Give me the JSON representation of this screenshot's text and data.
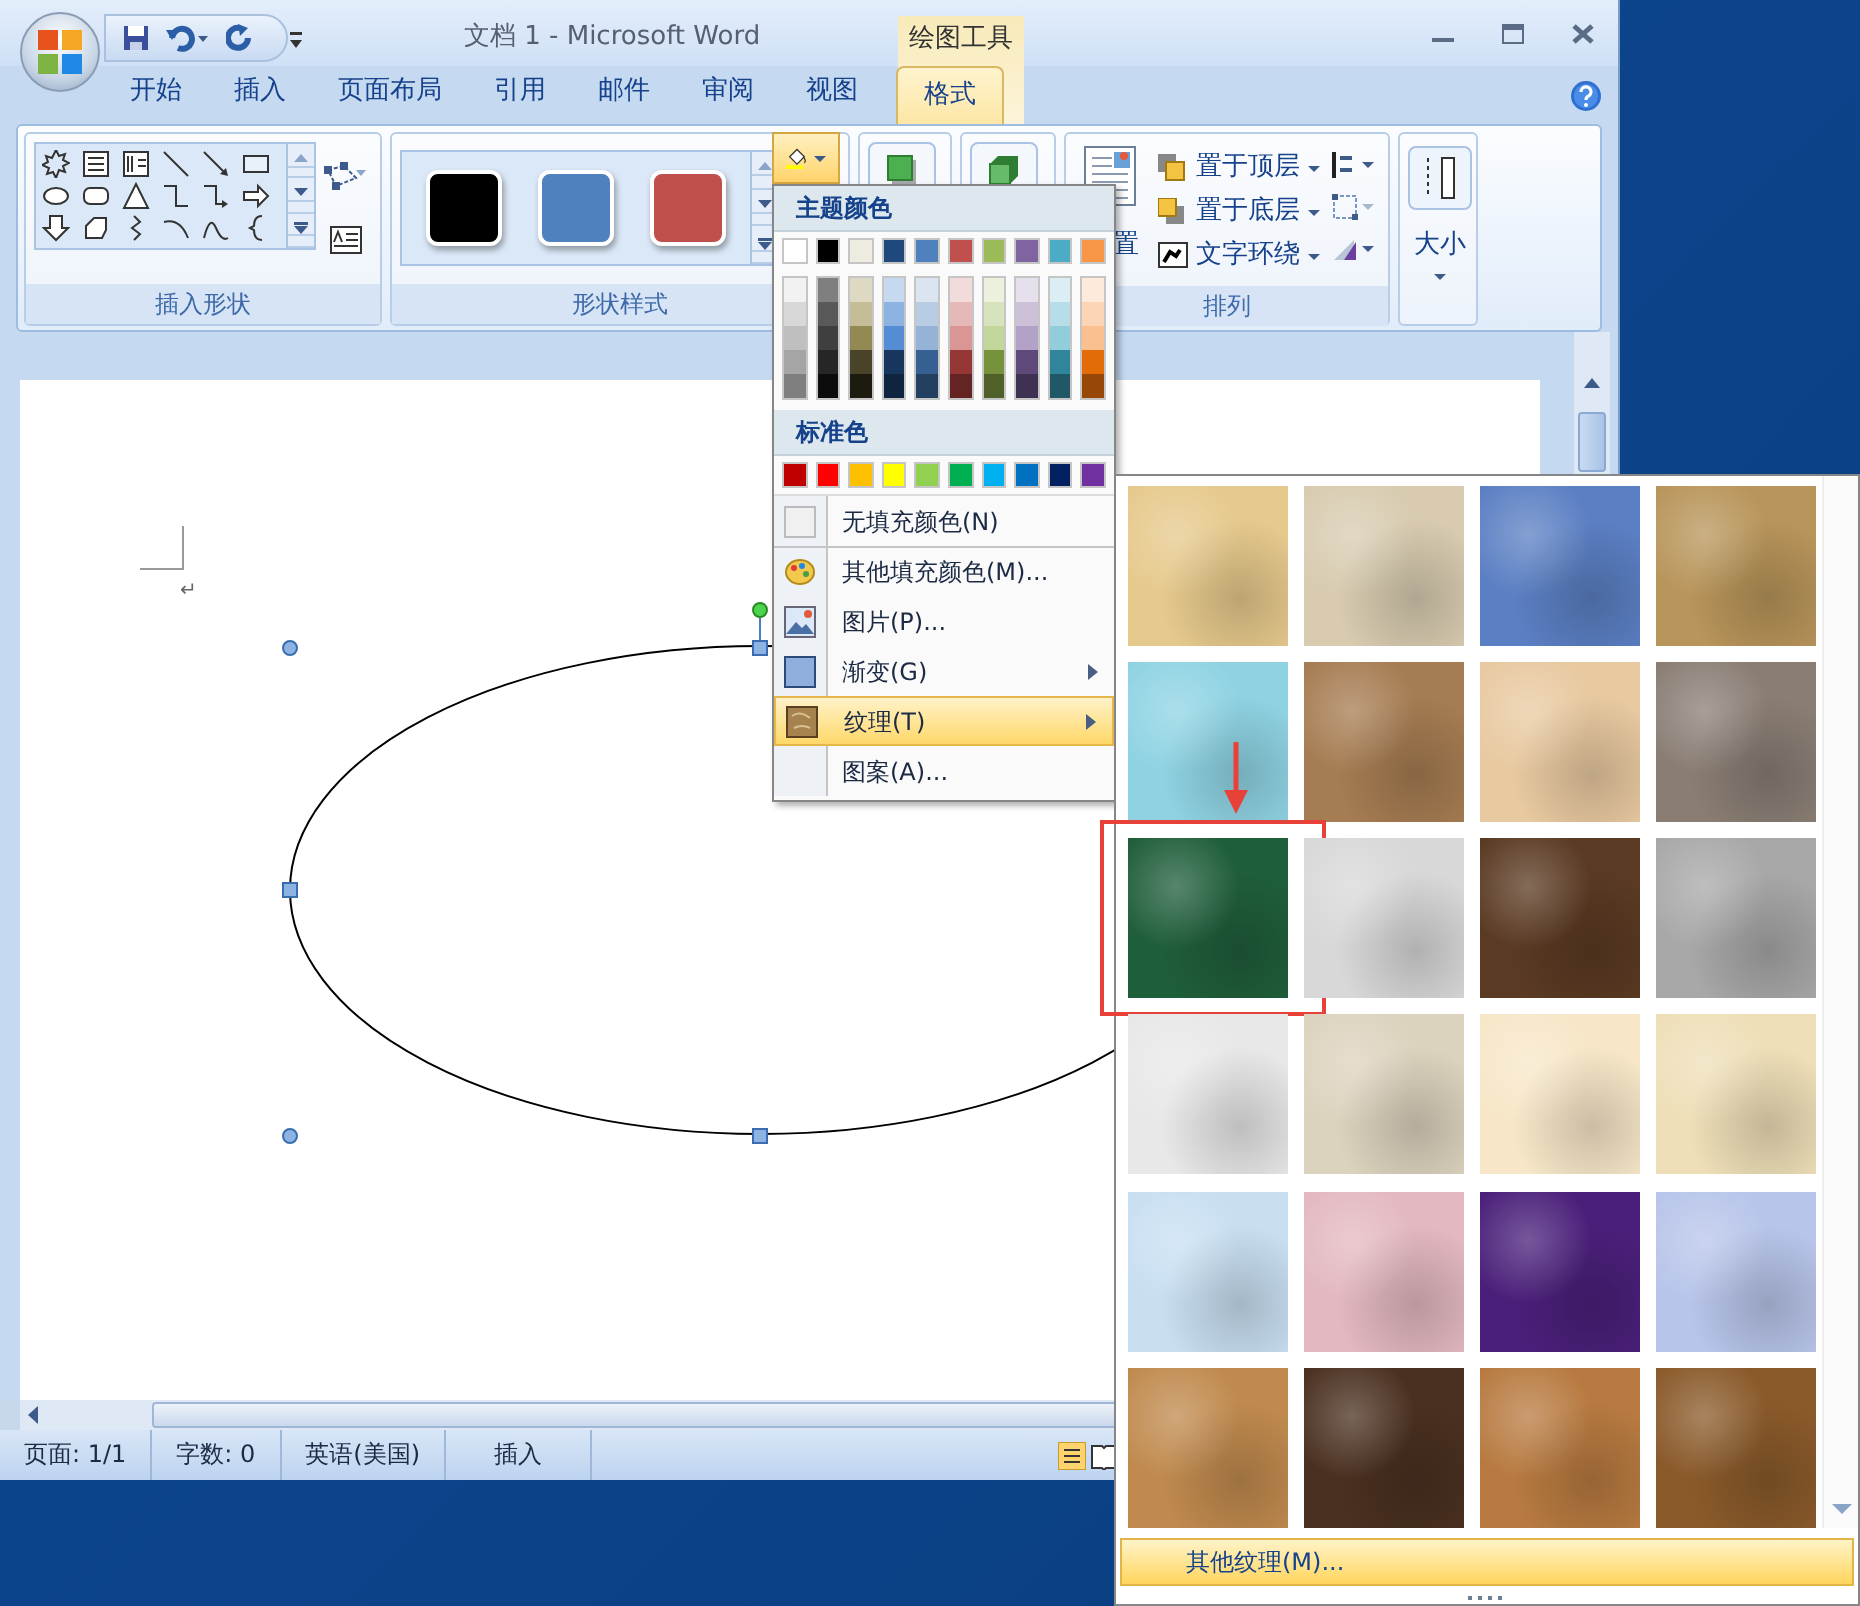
{
  "window": {
    "title": "文档 1 - Microsoft Word",
    "contextual_tab": "绘图工具"
  },
  "tabs": [
    {
      "label": "开始",
      "selected": false
    },
    {
      "label": "插入",
      "selected": false
    },
    {
      "label": "页面布局",
      "selected": false
    },
    {
      "label": "引用",
      "selected": false
    },
    {
      "label": "邮件",
      "selected": false
    },
    {
      "label": "审阅",
      "selected": false
    },
    {
      "label": "视图",
      "selected": false
    },
    {
      "label": "格式",
      "selected": true
    }
  ],
  "ribbon": {
    "groups": [
      {
        "kind": "shapes",
        "label": "插入形状"
      },
      {
        "kind": "styles",
        "label": "形状样式",
        "swatches": [
          {
            "color": "#000000"
          },
          {
            "color": "#4f81bd"
          },
          {
            "color": "#c0504d"
          }
        ]
      },
      {
        "kind": "effects"
      },
      {
        "kind": "effects3d"
      },
      {
        "kind": "arrange",
        "label": "排列",
        "position_label": "置",
        "commands": [
          {
            "label": "置于顶层"
          },
          {
            "label": "置于底层"
          },
          {
            "label": "文字环绕"
          }
        ]
      },
      {
        "kind": "size",
        "label": "大小"
      }
    ]
  },
  "document": {
    "paragraph_mark": "↵"
  },
  "status_bar": {
    "items": [
      "页面: 1/1",
      "字数: 0",
      "英语(美国)",
      "插入"
    ]
  },
  "fill_menu": {
    "theme_header": "主题颜色",
    "theme_colors": [
      {
        "color": "#ffffff",
        "shades": [
          {
            "color": "#f2f2f2"
          },
          {
            "color": "#d8d8d8"
          },
          {
            "color": "#bfbfbf"
          },
          {
            "color": "#a5a5a5"
          },
          {
            "color": "#7f7f7f"
          }
        ]
      },
      {
        "color": "#000000",
        "shades": [
          {
            "color": "#7f7f7f"
          },
          {
            "color": "#595959"
          },
          {
            "color": "#3f3f3f"
          },
          {
            "color": "#262626"
          },
          {
            "color": "#0c0c0c"
          }
        ]
      },
      {
        "color": "#eeece1",
        "shades": [
          {
            "color": "#ddd9c3"
          },
          {
            "color": "#c4bd97"
          },
          {
            "color": "#938953"
          },
          {
            "color": "#494429"
          },
          {
            "color": "#1d1b10"
          }
        ]
      },
      {
        "color": "#1f497d",
        "shades": [
          {
            "color": "#c6d9f0"
          },
          {
            "color": "#8db3e2"
          },
          {
            "color": "#548dd4"
          },
          {
            "color": "#17365d"
          },
          {
            "color": "#0f243e"
          }
        ]
      },
      {
        "color": "#4f81bd",
        "shades": [
          {
            "color": "#dbe5f1"
          },
          {
            "color": "#b8cce4"
          },
          {
            "color": "#95b3d7"
          },
          {
            "color": "#366092"
          },
          {
            "color": "#244061"
          }
        ]
      },
      {
        "color": "#c0504d",
        "shades": [
          {
            "color": "#f2dcdb"
          },
          {
            "color": "#e5b9b7"
          },
          {
            "color": "#d99694"
          },
          {
            "color": "#953734"
          },
          {
            "color": "#632423"
          }
        ]
      },
      {
        "color": "#9bbb59",
        "shades": [
          {
            "color": "#ebf1dd"
          },
          {
            "color": "#d7e3bc"
          },
          {
            "color": "#c3d69b"
          },
          {
            "color": "#76923c"
          },
          {
            "color": "#4f6128"
          }
        ]
      },
      {
        "color": "#8064a2",
        "shades": [
          {
            "color": "#e5e0ec"
          },
          {
            "color": "#ccc1d9"
          },
          {
            "color": "#b2a2c7"
          },
          {
            "color": "#5f497a"
          },
          {
            "color": "#3f3151"
          }
        ]
      },
      {
        "color": "#4bacc6",
        "shades": [
          {
            "color": "#dbeef3"
          },
          {
            "color": "#b7dde8"
          },
          {
            "color": "#92cddc"
          },
          {
            "color": "#31859b"
          },
          {
            "color": "#205867"
          }
        ]
      },
      {
        "color": "#f79646",
        "shades": [
          {
            "color": "#fdeada"
          },
          {
            "color": "#fbd5b5"
          },
          {
            "color": "#fac08f"
          },
          {
            "color": "#e36c09"
          },
          {
            "color": "#974806"
          }
        ]
      }
    ],
    "standard_header": "标准色",
    "standard_colors": [
      {
        "color": "#c00000"
      },
      {
        "color": "#ff0000"
      },
      {
        "color": "#ffc000"
      },
      {
        "color": "#ffff00"
      },
      {
        "color": "#92d050"
      },
      {
        "color": "#00b050"
      },
      {
        "color": "#00b0f0"
      },
      {
        "color": "#0070c0"
      },
      {
        "color": "#002060"
      },
      {
        "color": "#7030a0"
      }
    ],
    "items": [
      {
        "kind": "none",
        "label": "无填充颜色(N)",
        "submenu": false,
        "selected": false
      },
      {
        "kind": "palette",
        "label": "其他填充颜色(M)...",
        "submenu": false,
        "selected": false
      },
      {
        "kind": "picture",
        "label": "图片(P)...",
        "submenu": false,
        "selected": false
      },
      {
        "kind": "gradient",
        "label": "渐变(G)",
        "submenu": true,
        "selected": false
      },
      {
        "kind": "texture",
        "label": "纹理(T)",
        "submenu": true,
        "selected": true
      },
      {
        "kind": "pattern",
        "label": "图案(A)...",
        "submenu": false,
        "selected": false
      }
    ]
  },
  "texture_menu": {
    "textures": [
      {
        "color": "#e6c98c",
        "highlighted": false
      },
      {
        "color": "#d8cbb0",
        "highlighted": false
      },
      {
        "color": "#5b7fc3",
        "highlighted": false
      },
      {
        "color": "#b8955a",
        "highlighted": false
      },
      {
        "color": "#8fd3e3",
        "highlighted": false
      },
      {
        "color": "#a67c52",
        "highlighted": false
      },
      {
        "color": "#e8c9a0",
        "highlighted": false
      },
      {
        "color": "#8a7e74",
        "highlighted": false
      },
      {
        "color": "#1f5e3a",
        "highlighted": true
      },
      {
        "color": "#d8d8d8",
        "highlighted": false
      },
      {
        "color": "#5a3a22",
        "highlighted": false
      },
      {
        "color": "#a8a8a8",
        "highlighted": false
      },
      {
        "color": "#e8e8e8",
        "highlighted": false
      },
      {
        "color": "#dcd3be",
        "highlighted": false
      },
      {
        "color": "#f7e7c8",
        "highlighted": false
      },
      {
        "color": "#eedfb8",
        "highlighted": false
      },
      {
        "color": "#c8dff2",
        "highlighted": false
      },
      {
        "color": "#e3b8c0",
        "highlighted": false
      },
      {
        "color": "#4a1f7a",
        "highlighted": false
      },
      {
        "color": "#b8c5ea",
        "highlighted": false
      },
      {
        "color": "#c08a4e",
        "highlighted": false
      },
      {
        "color": "#4a3020",
        "highlighted": false
      },
      {
        "color": "#b87a40",
        "highlighted": false
      },
      {
        "color": "#8a5a2a",
        "highlighted": false
      }
    ],
    "more_label": "其他纹理(M)..."
  }
}
